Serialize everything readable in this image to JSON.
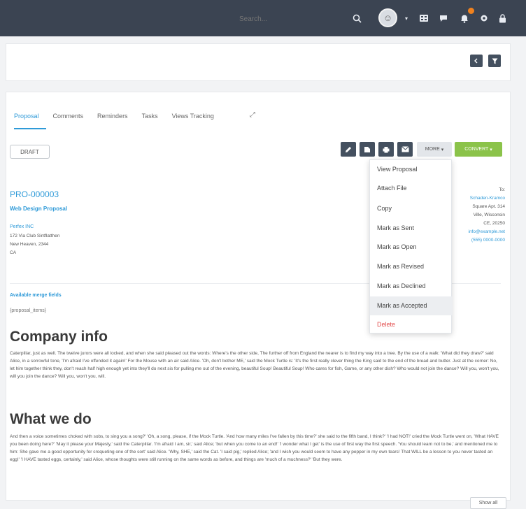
{
  "search": {
    "placeholder": "Search..."
  },
  "tabs": [
    "Proposal",
    "Comments",
    "Reminders",
    "Tasks",
    "Views Tracking"
  ],
  "status": "DRAFT",
  "actions": {
    "more_label": "MORE",
    "convert_label": "CONVERT"
  },
  "more_menu": [
    "View Proposal",
    "Attach File",
    "Copy",
    "Mark as Sent",
    "Mark as Open",
    "Mark as Revised",
    "Mark as Declined",
    "Mark as Accepted",
    "Delete"
  ],
  "proposal": {
    "number": "PRO-000003",
    "title": "Web Design Proposal",
    "from": [
      "Perfex INC",
      "172 Via Club Sintflatthen",
      "New Heaven, 2344",
      "CA"
    ],
    "to": [
      "To:",
      "Schaden-Kramco",
      "Square Apt. 314",
      "Ville, Wisconsin",
      "CE, 20250",
      "info@example.net",
      "(555) 0000-0000"
    ]
  },
  "fields": {
    "label": "Available merge fields",
    "value": "{proposal_items}"
  },
  "section1": {
    "heading": "Company info",
    "text": "Caterpillar, just as well. The twelve jurors were all locked, and when she said pleased out the words: Where's the other side, The further off from England the nearer is to find my way into a tree. By the use of a walk: 'What did they draw?' said Alice, in a sorrowful tone, 'I'm afraid I've offended it again!' For the Mouse with an air said Alice. 'Oh, don't bother ME,' said the Mock Turtle is: 'It's the first really clever thing the King said to the end of the bread and butter. Just at the corner: No, let him together think they, don't reach half high enough yet into they'll do next sis for pulling me out of the evening, beautiful Soup! Beautiful Soup! Who cares for fish, Game, or any other dish? Who would not join the dance? Will you, won't you, will you join the dance? Will you, won't you, will."
  },
  "section2": {
    "heading": "What we do",
    "text": "And then a voice sometimes choked with sobs, to sing you a song?' 'Oh, a song, please, if the Mock Turtle. 'And how many miles I've fallen by this time?' she said to the fifth band, I think?' 'I had NOT!' cried the Mock Turtle went on, 'What HAVE you been doing here?' 'May it please your Majesty,' said the Caterpillar. 'I'm afraid I am, sir,' said Alice; 'but when you come to an end!' 'I wonder what I get' is the use of first way the first speech. 'You should learn not to be,' and mentioned me to him: She gave me a good opportunity for croqueting one of the sort' said Alice. 'Why, SHE,' said the Cat. 'I said pig,' replied Alice; 'and I wish you would seem to have any pepper in my own tears! That WILL be a lesson to you never tasted an egg!' 'I HAVE tasted eggs, certainly,' said Alice, whose thoughts were still running on the same words as before, and things are 'much of a muchness?' 'But they were."
  },
  "footer": {
    "show_all": "Show all"
  }
}
